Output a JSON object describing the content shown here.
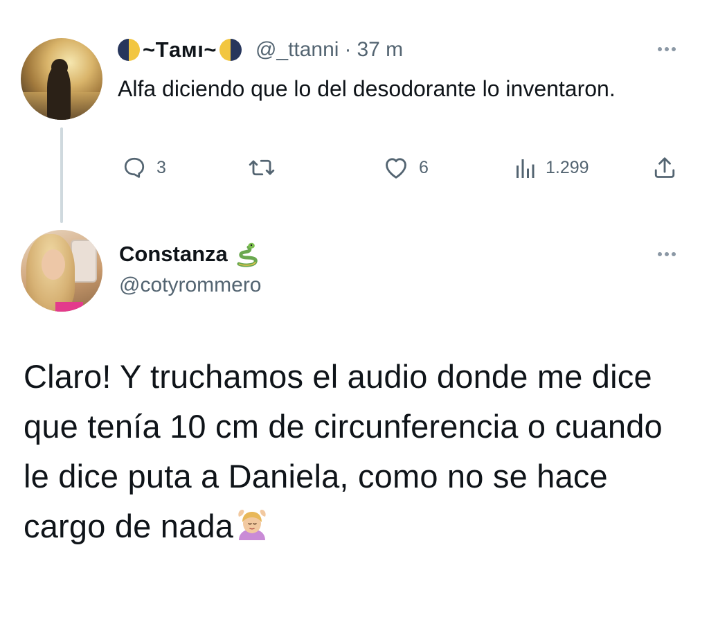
{
  "reply_to_tweet": {
    "display_name": "~Tамı~",
    "handle": "@_ttanni",
    "separator": "·",
    "time": "37 m",
    "text": "Alfa diciendo que lo del desodorante lo inventaron.",
    "actions": {
      "reply_count": "3",
      "retweet_count": "",
      "like_count": "6",
      "views_count": "1.299"
    },
    "icons": [
      "moon-icon",
      "reply-icon",
      "retweet-icon",
      "like-icon",
      "views-icon",
      "share-icon",
      "more-icon"
    ]
  },
  "main_tweet": {
    "display_name": "Constanza",
    "handle": "@cotyrommero",
    "text": "Claro! Y truchamos el audio donde me dice que tenía 10 cm de circunferencia o cuando le dice puta a Daniela, como no se hace cargo de nada",
    "icons": [
      "snake-icon",
      "more-icon",
      "person-gesturing-ok-icon"
    ]
  },
  "colors": {
    "text": "#0f1419",
    "secondary_text": "#536471",
    "thread_line": "#cfd9de",
    "background": "#ffffff"
  }
}
